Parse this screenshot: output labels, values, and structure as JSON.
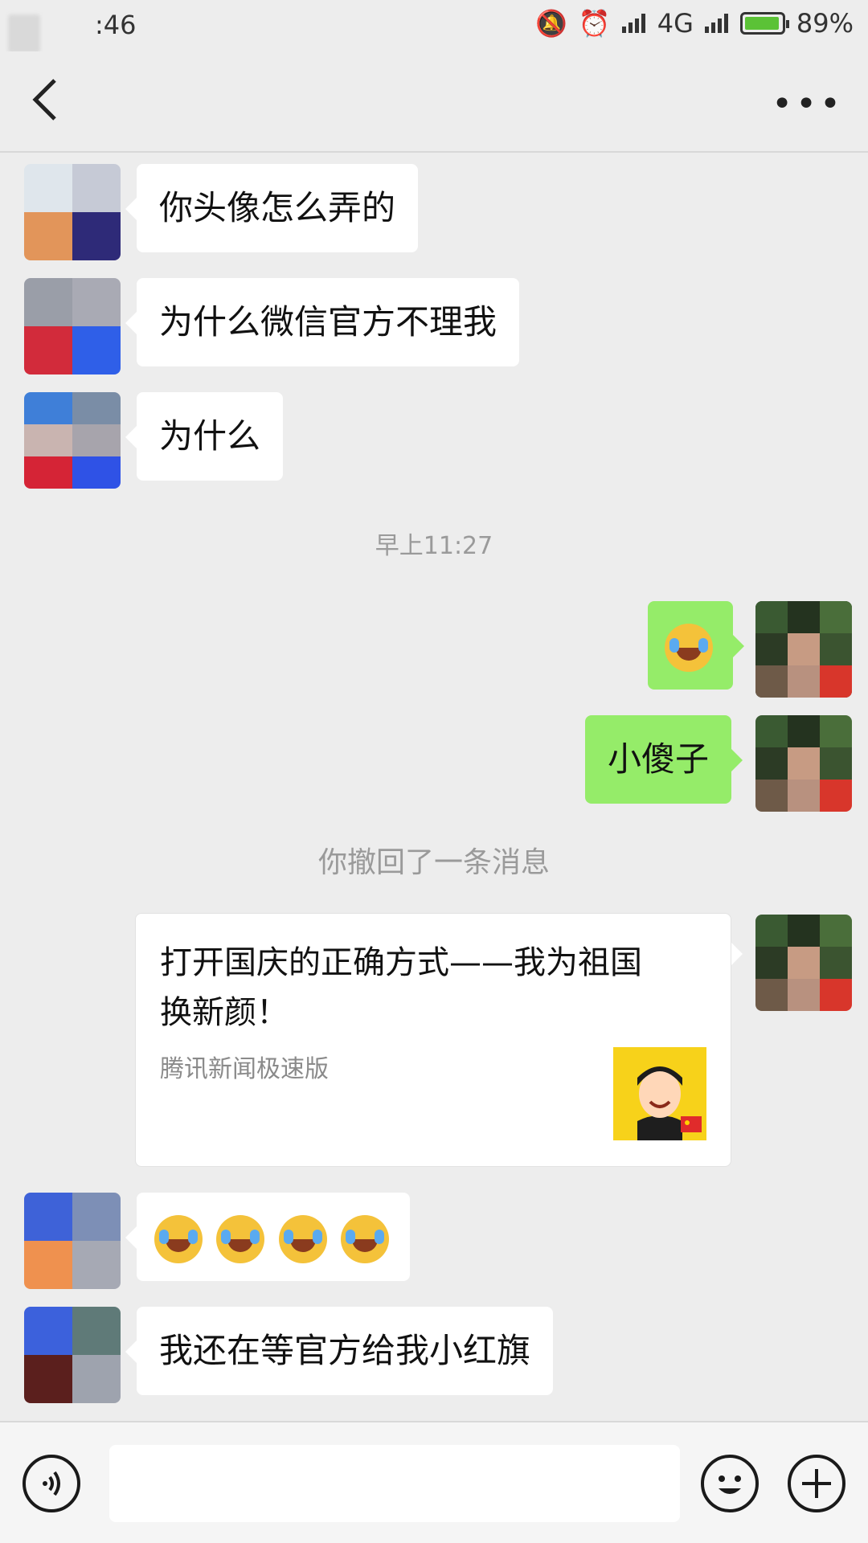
{
  "status_bar": {
    "time": ":46",
    "network": "4G",
    "battery": "89%"
  },
  "header": {
    "back": "back",
    "more": "•••"
  },
  "messages": [
    {
      "side": "left",
      "text": "你头像怎么弄的"
    },
    {
      "side": "left",
      "text": "为什么微信官方不理我"
    },
    {
      "side": "left",
      "text": "为什么"
    },
    {
      "side": "right",
      "text": "小傻子"
    },
    {
      "side": "left",
      "text": "我还在等官方给我小红旗"
    }
  ],
  "timestamp": "早上11:27",
  "recall_notice": "你撤回了一条消息",
  "link_card": {
    "title": "打开国庆的正确方式——我为祖国换新颜！",
    "source": "腾讯新闻极速版"
  },
  "colors": {
    "green_bubble": "#95ec69",
    "background": "#ededed",
    "battery_fill": "#5bc236"
  },
  "icons": [
    "back-icon",
    "more-icon",
    "voice-icon",
    "emoji-icon",
    "plus-icon"
  ]
}
